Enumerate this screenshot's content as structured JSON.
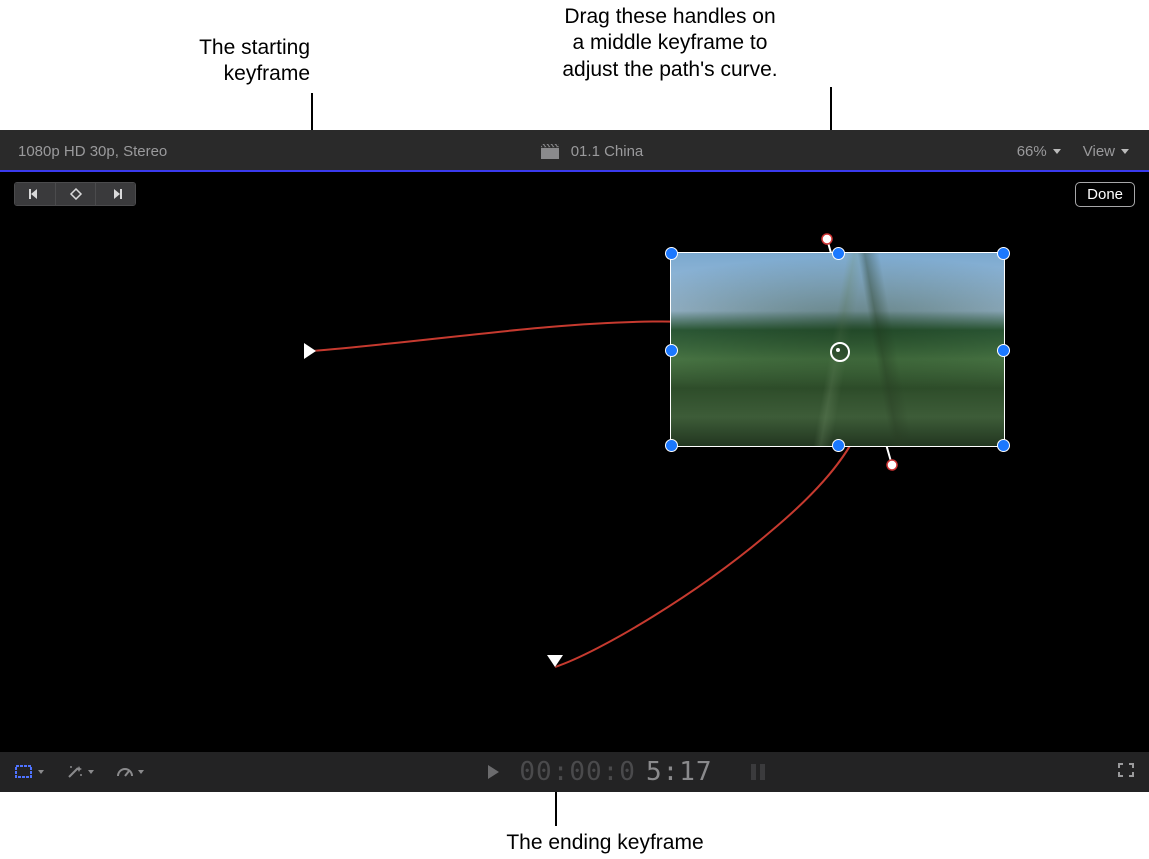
{
  "callouts": {
    "start": "The starting\nkeyframe",
    "handles": "Drag these handles on\na middle keyframe to\nadjust the path's curve.",
    "end": "The ending keyframe"
  },
  "topbar": {
    "format": "1080p HD 30p, Stereo",
    "clip_name": "01.1 China",
    "zoom": "66%",
    "view_label": "View"
  },
  "viewer": {
    "done_label": "Done"
  },
  "timecode": {
    "dim_prefix": "00:00:0",
    "value": "5:17"
  },
  "icons": {
    "clapper": "clapperboard-icon",
    "crop": "crop-tool-icon",
    "wand": "enhance-wand-icon",
    "retime": "retime-speed-icon",
    "fullscreen": "fullscreen-icon",
    "prev_kf": "previous-keyframe-icon",
    "add_kf": "add-delete-keyframe-icon",
    "next_kf": "next-keyframe-icon"
  },
  "colors": {
    "path": "#c63a2f",
    "handle_blue": "#1b78ff",
    "accent_divider": "#3a3aee"
  }
}
